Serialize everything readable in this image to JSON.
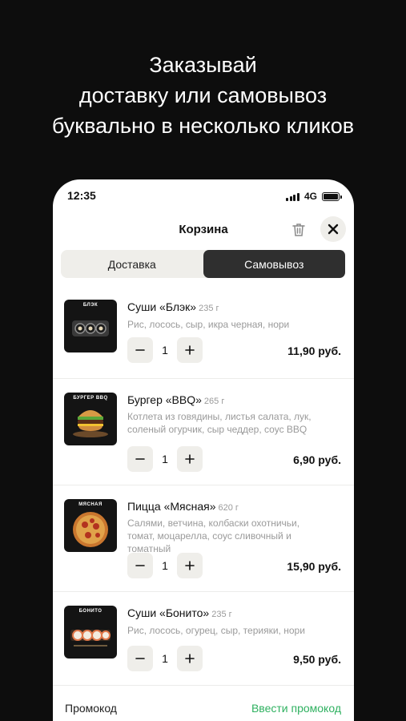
{
  "promo": {
    "line1": "Заказывай",
    "line2": "доставку или самовывоз",
    "line3": "буквально в несколько кликов"
  },
  "status": {
    "time": "12:35",
    "network": "4G"
  },
  "header": {
    "title": "Корзина"
  },
  "segment": {
    "delivery": "Доставка",
    "pickup": "Самовывоз",
    "selected": "Самовывоз"
  },
  "items": [
    {
      "name": "Суши «Блэк»",
      "weight": "235 г",
      "desc": "Рис, лосось, сыр, икра черная, нори",
      "qty": "1",
      "price": "11,90 руб.",
      "thumb_label": "БЛЭК"
    },
    {
      "name": "Бургер «BBQ»",
      "weight": "265 г",
      "desc": "Котлета из говядины, листья салата, лук, соленый огурчик, сыр чеддер, соус BBQ",
      "qty": "1",
      "price": "6,90 руб.",
      "thumb_label": "БУРГЕР BBQ"
    },
    {
      "name": "Пицца «Мясная»",
      "weight": "620 г",
      "desc": "Салями, ветчина, колбаски охотничьи, томат, моцарелла, соус сливочный и томатный",
      "qty": "1",
      "price": "15,90 руб.",
      "thumb_label": "МЯСНАЯ"
    },
    {
      "name": "Суши «Бонито»",
      "weight": "235 г",
      "desc": "Рис, лосось, огурец, сыр, терияки, нори",
      "qty": "1",
      "price": "9,50 руб.",
      "thumb_label": "БОНИТО"
    }
  ],
  "footer": {
    "promo_label": "Промокод",
    "promo_link": "Ввести промокод"
  },
  "colors": {
    "accent": "#2fb160",
    "dark": "#2f2f2f",
    "chip": "#efeeea"
  }
}
